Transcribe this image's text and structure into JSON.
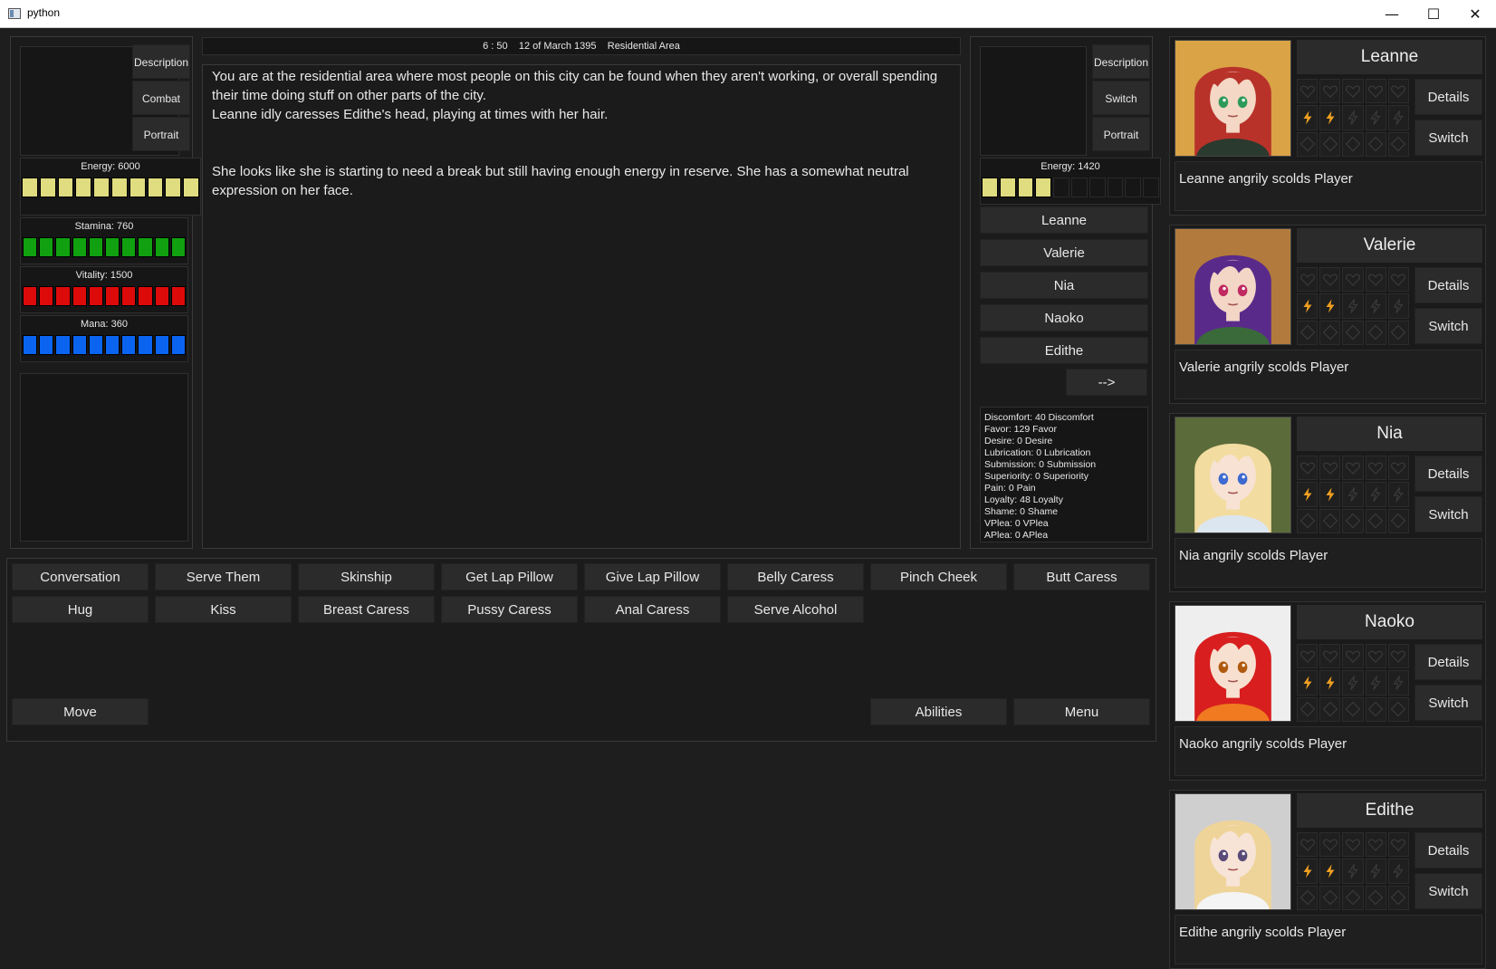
{
  "window": {
    "title": "python",
    "minimize": "—",
    "maximize": "☐",
    "close": "✕"
  },
  "header": {
    "time": "6 : 50",
    "date": "12 of March 1395",
    "location": "Residential Area"
  },
  "left_panel": {
    "buttons": [
      "Description",
      "Combat",
      "Portrait"
    ],
    "stats": [
      {
        "label": "Energy: 6000",
        "color": "#e0dc80",
        "filled": 10,
        "total": 10
      },
      {
        "label": "Stamina: 760",
        "color": "#10a010",
        "filled": 10,
        "total": 10
      },
      {
        "label": "Vitality: 1500",
        "color": "#dd0a0a",
        "filled": 10,
        "total": 10
      },
      {
        "label": "Mana: 360",
        "color": "#0a64f0",
        "filled": 10,
        "total": 10
      }
    ]
  },
  "story": {
    "paragraphs": [
      "You are at the residential area where most people on this city can be found when they aren't working, or overall spending their time doing stuff on other parts of the city.",
      "Leanne idly caresses Edithe's head, playing at times with her hair.",
      "",
      "",
      "She looks like she is starting to need a break but still having enough energy in reserve. She has a somewhat neutral expression on her face."
    ]
  },
  "right_panel": {
    "buttons": [
      "Description",
      "Switch",
      "Portrait"
    ],
    "energy": {
      "label": "Energy: 1420",
      "color": "#e0dc80",
      "filled": 4,
      "total": 10
    },
    "party": [
      "Leanne",
      "Valerie",
      "Nia",
      "Naoko",
      "Edithe"
    ],
    "next": "-->",
    "stats": [
      "Discomfort: 40 Discomfort",
      "Favor: 129 Favor",
      "Desire: 0 Desire",
      "Lubrication: 0 Lubrication",
      "Submission: 0 Submission",
      "Superiority: 0 Superiority",
      "Pain: 0 Pain",
      "Loyalty: 48 Loyalty",
      "Shame: 0 Shame",
      "VPlea: 0 VPlea",
      "APlea: 0 APlea"
    ]
  },
  "actions": {
    "row1": [
      "Conversation",
      "Serve Them",
      "Skinship",
      "Get Lap Pillow",
      "Give Lap Pillow",
      "Belly Caress",
      "Pinch Cheek",
      "Butt Caress"
    ],
    "row2": [
      "Hug",
      "Kiss",
      "Breast Caress",
      "Pussy Caress",
      "Anal Caress",
      "Serve Alcohol"
    ],
    "move": "Move",
    "abilities": "Abilities",
    "menu": "Menu"
  },
  "characters": [
    {
      "name": "Leanne",
      "details": "Details",
      "switch": "Switch",
      "message": "Leanne angrily scolds Player",
      "hair": "#b8322a",
      "bg": "#d9a346",
      "eyes": "#2e9a5a",
      "outfit": "#2b3a2e",
      "skin": "#f4d7c4"
    },
    {
      "name": "Valerie",
      "details": "Details",
      "switch": "Switch",
      "message": "Valerie angrily scolds Player",
      "hair": "#5a2a8a",
      "bg": "#b27a3c",
      "eyes": "#c02a60",
      "outfit": "#3a6a3a",
      "skin": "#f3d6c6"
    },
    {
      "name": "Nia",
      "details": "Details",
      "switch": "Switch",
      "message": "Nia angrily scolds Player",
      "hair": "#f2dca0",
      "bg": "#5c6b3a",
      "eyes": "#3c6ad0",
      "outfit": "#dce6f0",
      "skin": "#f7e2d4"
    },
    {
      "name": "Naoko",
      "details": "Details",
      "switch": "Switch",
      "message": "Naoko angrily scolds Player",
      "hair": "#d81e1e",
      "bg": "#eeeeee",
      "eyes": "#b05a10",
      "outfit": "#f07a20",
      "skin": "#f7e0d0"
    },
    {
      "name": "Edithe",
      "details": "Details",
      "switch": "Switch",
      "message": "Edithe angrily scolds Player",
      "hair": "#efd49a",
      "bg": "#cfcfcf",
      "eyes": "#5a4a7a",
      "outfit": "#f4f4f4",
      "skin": "#f7e4d6"
    }
  ],
  "status_icons": {
    "hearts": 5,
    "energy_filled": 2,
    "energy_total": 5,
    "diamonds": 5,
    "bolt_color": "#f0a020"
  }
}
